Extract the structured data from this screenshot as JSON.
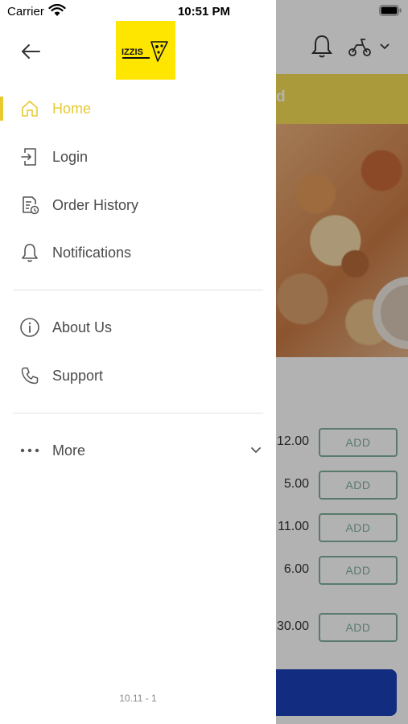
{
  "status_bar": {
    "carrier": "Carrier",
    "time": "10:51 PM"
  },
  "background": {
    "banner_text": "d",
    "prices": [
      "12.00",
      "5.00",
      "11.00",
      "6.00",
      "30.00"
    ],
    "add_label": "ADD"
  },
  "drawer": {
    "logo_text": "IZZIS",
    "menu": [
      {
        "label": "Home",
        "icon": "home-icon",
        "active": true
      },
      {
        "label": "Login",
        "icon": "login-icon",
        "active": false
      },
      {
        "label": "Order History",
        "icon": "order-history-icon",
        "active": false
      },
      {
        "label": "Notifications",
        "icon": "bell-icon",
        "active": false
      }
    ],
    "menu2": [
      {
        "label": "About Us",
        "icon": "info-icon"
      },
      {
        "label": "Support",
        "icon": "phone-icon"
      }
    ],
    "more_label": "More",
    "version": "10.11 - 1"
  },
  "colors": {
    "accent": "#e8c92f",
    "logo_bg": "#ffe600",
    "text": "#4a4a4a",
    "add_border": "#7fb09a",
    "cta": "#1a3fb8"
  }
}
